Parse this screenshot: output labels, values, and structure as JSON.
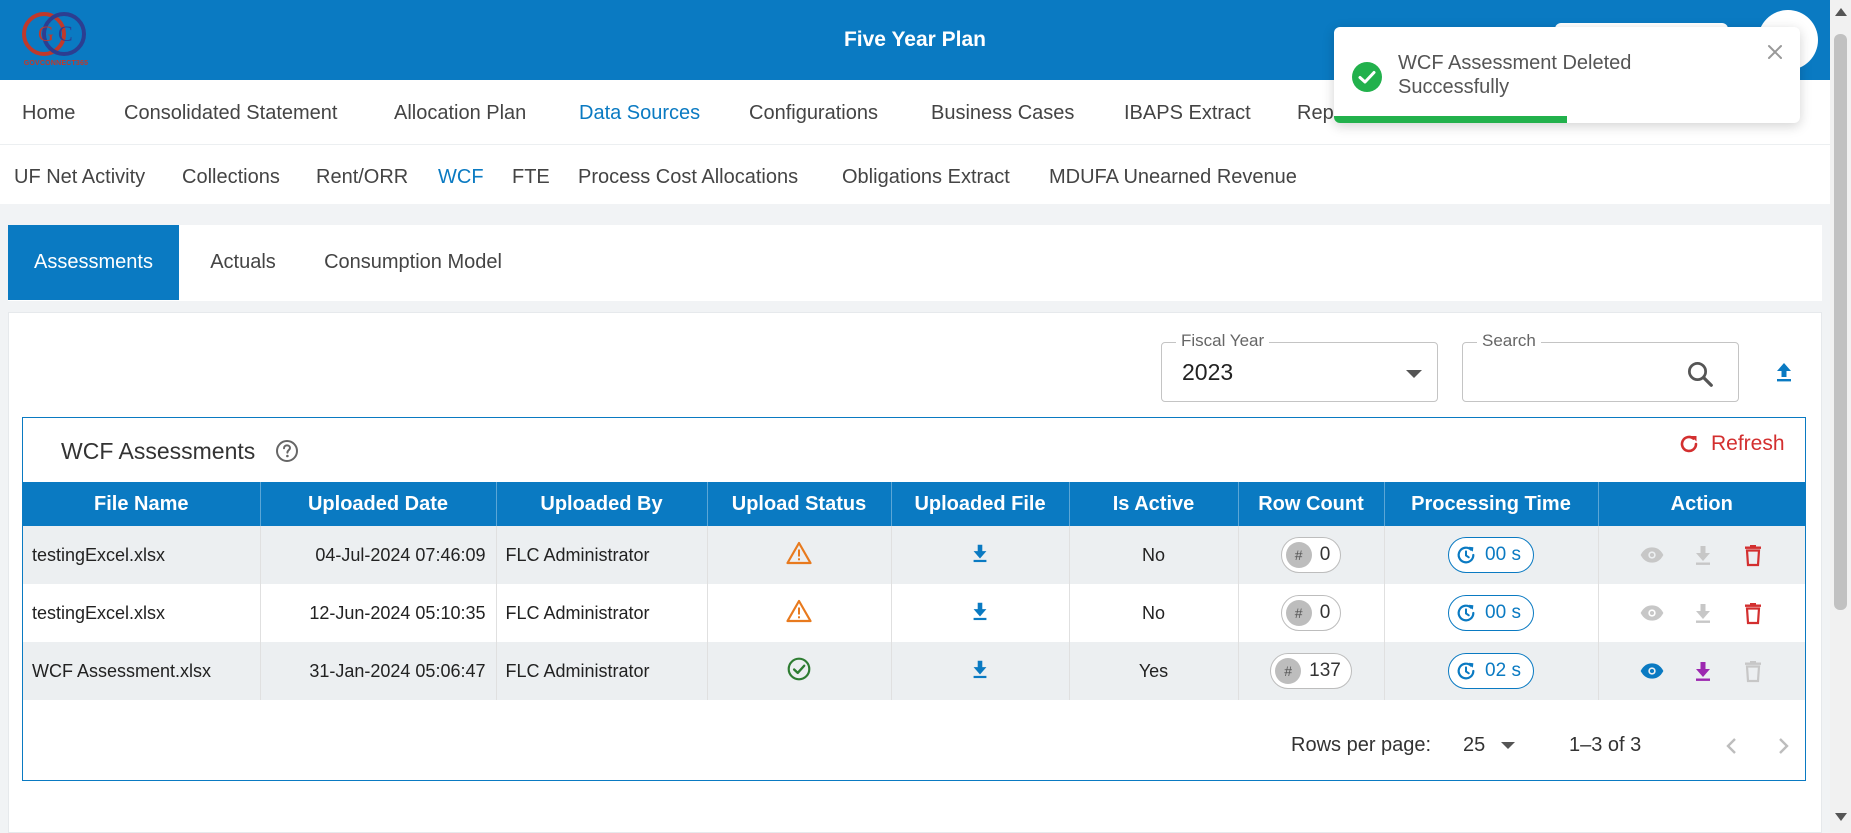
{
  "header": {
    "title": "Five Year Plan",
    "logo_text": "GOVCONNECT365"
  },
  "main_nav": [
    {
      "label": "Home",
      "active": false
    },
    {
      "label": "Consolidated Statement",
      "active": false
    },
    {
      "label": "Allocation Plan",
      "active": false
    },
    {
      "label": "Data Sources",
      "active": true
    },
    {
      "label": "Configurations",
      "active": false
    },
    {
      "label": "Business Cases",
      "active": false
    },
    {
      "label": "IBAPS Extract",
      "active": false
    },
    {
      "label": "Rep",
      "active": false
    }
  ],
  "sub_nav": [
    {
      "label": "UF Net Activity",
      "active": false
    },
    {
      "label": "Collections",
      "active": false
    },
    {
      "label": "Rent/ORR",
      "active": false
    },
    {
      "label": "WCF",
      "active": true
    },
    {
      "label": "FTE",
      "active": false
    },
    {
      "label": "Process Cost Allocations",
      "active": false
    },
    {
      "label": "Obligations Extract",
      "active": false
    },
    {
      "label": "MDUFA Unearned Revenue",
      "active": false
    }
  ],
  "tabs": [
    {
      "label": "Assessments",
      "active": true
    },
    {
      "label": "Actuals",
      "active": false
    },
    {
      "label": "Consumption Model",
      "active": false
    }
  ],
  "filters": {
    "fiscal_year_label": "Fiscal Year",
    "fiscal_year_value": "2023",
    "search_label": "Search",
    "search_value": ""
  },
  "table": {
    "title": "WCF Assessments",
    "refresh_label": "Refresh",
    "columns": [
      "File Name",
      "Uploaded Date",
      "Uploaded By",
      "Upload Status",
      "Uploaded File",
      "Is Active",
      "Row Count",
      "Processing Time",
      "Action"
    ],
    "rows": [
      {
        "file_name": "testingExcel.xlsx",
        "uploaded_date": "04-Jul-2024 07:46:09",
        "uploaded_by": "FLC Administrator",
        "status": "warning",
        "is_active": "No",
        "row_count": "0",
        "processing_time": "00 s",
        "row_count_symbol": "#"
      },
      {
        "file_name": "testingExcel.xlsx",
        "uploaded_date": "12-Jun-2024 05:10:35",
        "uploaded_by": "FLC Administrator",
        "status": "warning",
        "is_active": "No",
        "row_count": "0",
        "processing_time": "00 s",
        "row_count_symbol": "#"
      },
      {
        "file_name": "WCF Assessment.xlsx",
        "uploaded_date": "31-Jan-2024 05:06:47",
        "uploaded_by": "FLC Administrator",
        "status": "success",
        "is_active": "Yes",
        "row_count": "137",
        "processing_time": "02 s",
        "row_count_symbol": "#"
      }
    ]
  },
  "pagination": {
    "rows_per_page_label": "Rows per page:",
    "rows_per_page_value": "25",
    "range_text": "1–3 of 3"
  },
  "toast": {
    "message": "WCF Assessment Deleted Successfully",
    "progress": 0.5
  },
  "colors": {
    "primary": "#0a7ac2",
    "danger": "#d32f2f",
    "warning": "#e87a1e",
    "success": "#2e7d32",
    "download_active": "#9c27b0"
  }
}
